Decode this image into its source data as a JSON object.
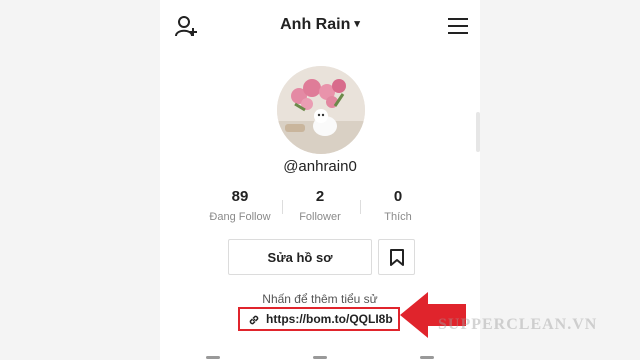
{
  "header": {
    "username": "Anh Rain",
    "username_caret": "▾",
    "add_user_icon": "person-add-icon",
    "menu_icon": "hamburger-menu-icon"
  },
  "profile": {
    "handle": "@anhrain0",
    "avatar": "profile-photo-roses-and-dog"
  },
  "stats": [
    {
      "value": "89",
      "label": "Đang Follow"
    },
    {
      "value": "2",
      "label": "Follower"
    },
    {
      "value": "0",
      "label": "Thích"
    }
  ],
  "actions": {
    "edit_profile_label": "Sửa hồ sơ",
    "bookmark_icon": "bookmark-icon"
  },
  "bio": {
    "hint": "Nhấn để thêm tiểu sử",
    "link": "https://bom.to/QQLI8b",
    "link_icon": "link-chain-icon"
  },
  "annotation": {
    "arrow_color": "#e0242c",
    "highlight_color": "#e0242c"
  },
  "watermark": "SUPPERCLEAN.VN"
}
